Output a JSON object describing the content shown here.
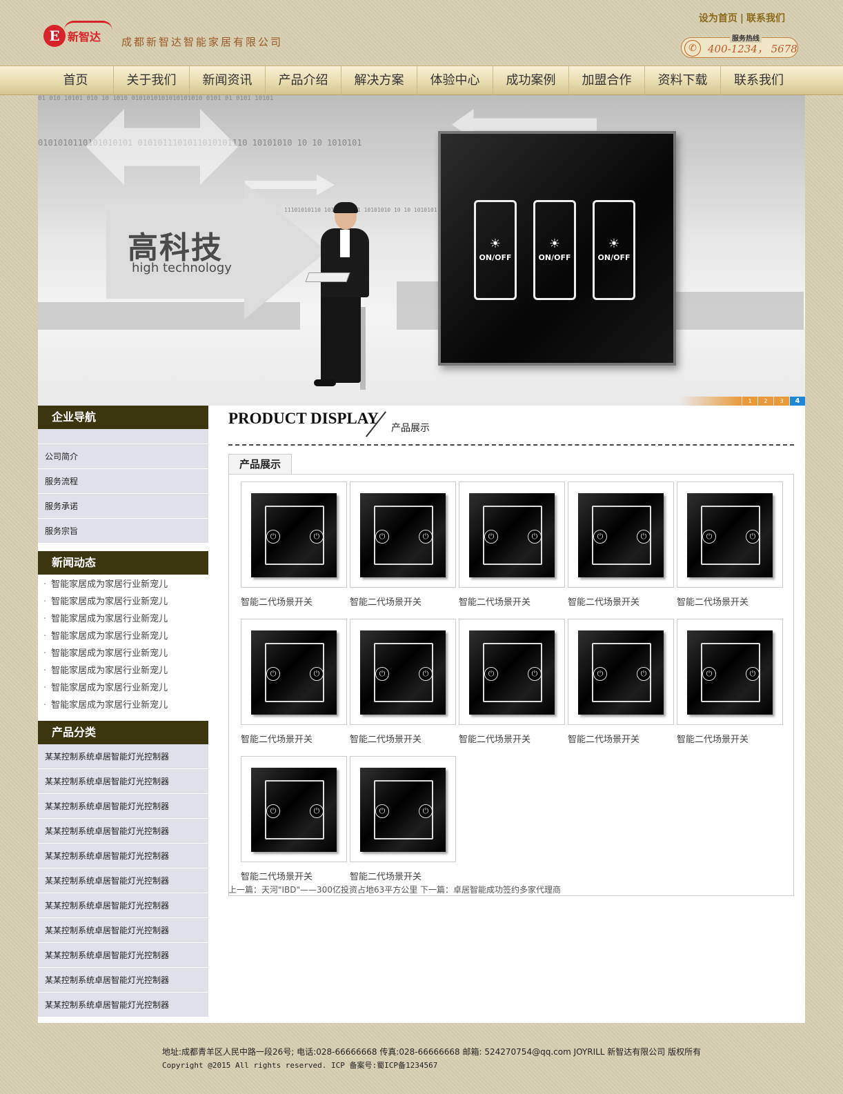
{
  "header": {
    "brand": "新智达",
    "company_name": "成都新智达智能家居有限公司",
    "links": [
      "设为首页",
      "联系我们"
    ],
    "hotline_label": "服务热线",
    "hotline_number": "400-1234， 5678"
  },
  "nav": {
    "items": [
      "首页",
      "关于我们",
      "新闻资讯",
      "产品介绍",
      "解决方案",
      "体验中心",
      "成功案例",
      "加盟合作",
      "资料下载",
      "联系我们"
    ]
  },
  "banner": {
    "headline_cn": "高科技",
    "headline_en": "high technology",
    "switch_label": "ON/OFF",
    "pager": [
      "1",
      "2",
      "3",
      "4"
    ],
    "active_page": 4,
    "binary_lines": [
      "01 010 10101 010 10 1010 0101010101010101010 0101 01 0101 10101",
      "0101010110101010101 0101011101011010101110 10101010 10 10 1010101",
      "11101010110 10101010101 10101010 10 10 1010101"
    ]
  },
  "sidebar": {
    "nav_title": "企业导航",
    "nav_items": [
      "公司简介",
      "服务流程",
      "服务承诺",
      "服务宗旨"
    ],
    "news_title": "新闻动态",
    "news_items": [
      "智能家居成为家居行业新宠儿",
      "智能家居成为家居行业新宠儿",
      "智能家居成为家居行业新宠儿",
      "智能家居成为家居行业新宠儿",
      "智能家居成为家居行业新宠儿",
      "智能家居成为家居行业新宠儿",
      "智能家居成为家居行业新宠儿",
      "智能家居成为家居行业新宠儿"
    ],
    "category_title": "产品分类",
    "category_items": [
      "某某控制系统卓居智能灯光控制器",
      "某某控制系统卓居智能灯光控制器",
      "某某控制系统卓居智能灯光控制器",
      "某某控制系统卓居智能灯光控制器",
      "某某控制系统卓居智能灯光控制器",
      "某某控制系统卓居智能灯光控制器",
      "某某控制系统卓居智能灯光控制器",
      "某某控制系统卓居智能灯光控制器",
      "某某控制系统卓居智能灯光控制器",
      "某某控制系统卓居智能灯光控制器",
      "某某控制系统卓居智能灯光控制器"
    ]
  },
  "main": {
    "title_en": "PRODUCT DISPLAY",
    "title_cn": "产品展示",
    "tab_label": "产品展示",
    "products": [
      "智能二代场景开关",
      "智能二代场景开关",
      "智能二代场景开关",
      "智能二代场景开关",
      "智能二代场景开关",
      "智能二代场景开关",
      "智能二代场景开关",
      "智能二代场景开关",
      "智能二代场景开关",
      "智能二代场景开关",
      "智能二代场景开关",
      "智能二代场景开关"
    ],
    "prev_next": "上一篇：天河\"IBD\"——300亿投资占地63平方公里  下一篇：卓居智能成功签约多家代理商"
  },
  "footer": {
    "line1": "地址:成都青羊区人民中路一段26号; 电话:028-66666668 传真:028-66666668 邮箱: 524270754@qq.com JOYRILL 新智达有限公司 版权所有",
    "line2": "Copyright @2015 All rights reserved. ICP 备案号:蜀ICP备1234567"
  }
}
